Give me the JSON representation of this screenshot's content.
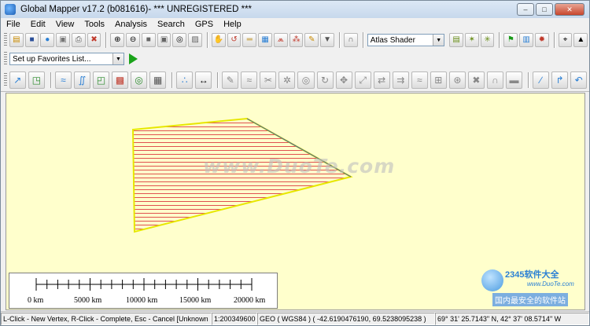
{
  "window": {
    "title": "Global Mapper v17.2 (b081616)- *** UNREGISTERED ***",
    "controls": [
      "minimize",
      "maximize",
      "close"
    ]
  },
  "menu": [
    "File",
    "Edit",
    "View",
    "Tools",
    "Analysis",
    "Search",
    "GPS",
    "Help"
  ],
  "toolbar1": {
    "shader_select": "Atlas Shader"
  },
  "toolbar2": {
    "favorites_select": "Set up Favorites List..."
  },
  "map": {
    "background": "#ffffcc",
    "feature_colors": {
      "outline": "#ffff00",
      "hatch": "#e05050"
    },
    "watermark": "www.DuoTe.com",
    "scale_labels": [
      "0 km",
      "5000 km",
      "10000 km",
      "15000 km",
      "20000 km"
    ],
    "brand": {
      "logo": "2345软件大全",
      "url": "www.DuoTe.com",
      "slogan": "国内最安全的软件站"
    }
  },
  "statusbar": {
    "hint": "L-Click - New Vertex, R-Click - Complete, Esc - Cancel [Unknown",
    "scale": "1:200349600",
    "projection": "GEO ( WGS84 ) ( -42.6190476190, 69.5238095238 )",
    "coords": "69° 31' 25.7143\" N, 42° 37' 08.5714\" W"
  }
}
